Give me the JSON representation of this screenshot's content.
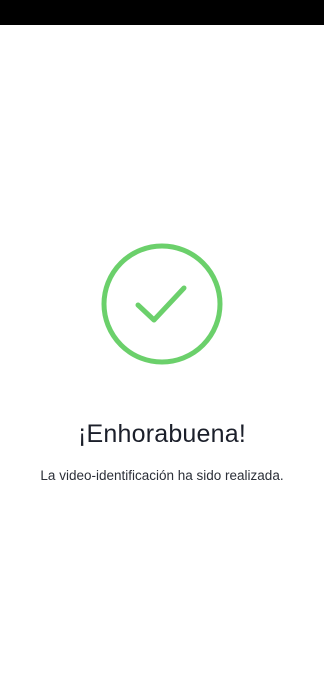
{
  "colors": {
    "status_bar": "#000000",
    "background": "#ffffff",
    "success_green": "#6bd06b",
    "title_text": "#1b1f2a",
    "body_text": "#2b2f38"
  },
  "success": {
    "icon": "check-circle-icon",
    "title": "¡Enhorabuena!",
    "message": "La video-identificación ha sido realizada."
  }
}
